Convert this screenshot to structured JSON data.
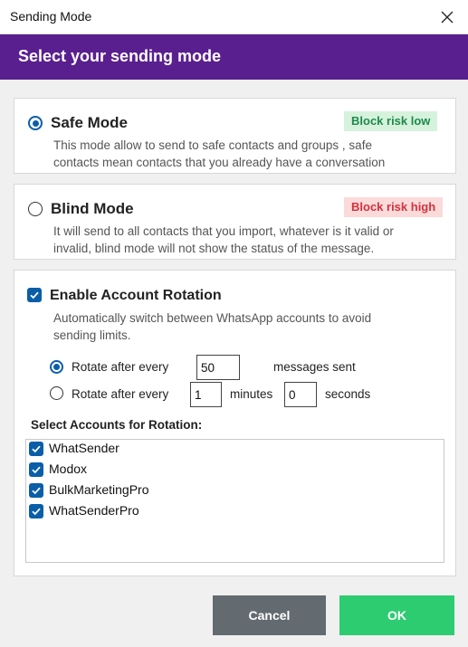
{
  "window": {
    "title": "Sending Mode"
  },
  "header": {
    "title": "Select your sending mode"
  },
  "safe_mode": {
    "label": "Safe Mode",
    "selected": true,
    "badge": "Block risk low",
    "badge_color": "#1e8a4a",
    "badge_bg": "#d6f2dd",
    "description_line1": "This mode allow to send to safe contacts and groups , safe",
    "description_line2": "contacts mean contacts that you already have a conversation"
  },
  "blind_mode": {
    "label": "Blind Mode",
    "selected": false,
    "badge": "Block risk high",
    "badge_color": "#d3323f",
    "badge_bg": "#fbdada",
    "description_line1": "It will send to all contacts that you import, whatever is it valid or",
    "description_line2": "invalid, blind mode will not show the status of the message."
  },
  "rotation": {
    "enable_label": "Enable Account Rotation",
    "enabled": true,
    "description_line1": "Automatically switch between WhatsApp accounts to avoid",
    "description_line2": "sending limits.",
    "option_messages": {
      "label": "Rotate after every",
      "value": "50",
      "suffix": "messages sent",
      "selected": true
    },
    "option_time": {
      "label": "Rotate after every",
      "minutes_value": "1",
      "minutes_label": "minutes",
      "seconds_value": "0",
      "seconds_label": "seconds",
      "selected": false
    },
    "accounts_label": "Select Accounts for Rotation:",
    "accounts": [
      {
        "name": "WhatSender",
        "checked": true
      },
      {
        "name": "Modox",
        "checked": true
      },
      {
        "name": "BulkMarketingPro",
        "checked": true
      },
      {
        "name": "WhatSenderPro",
        "checked": true
      }
    ]
  },
  "buttons": {
    "cancel": "Cancel",
    "ok": "OK",
    "cancel_color": "#636b70",
    "ok_color": "#2ecc71"
  },
  "colors": {
    "header_bg": "#5a1f8f",
    "accent": "#0a5ea8"
  },
  "icons": {
    "close": "close-icon",
    "check": "check-icon"
  }
}
